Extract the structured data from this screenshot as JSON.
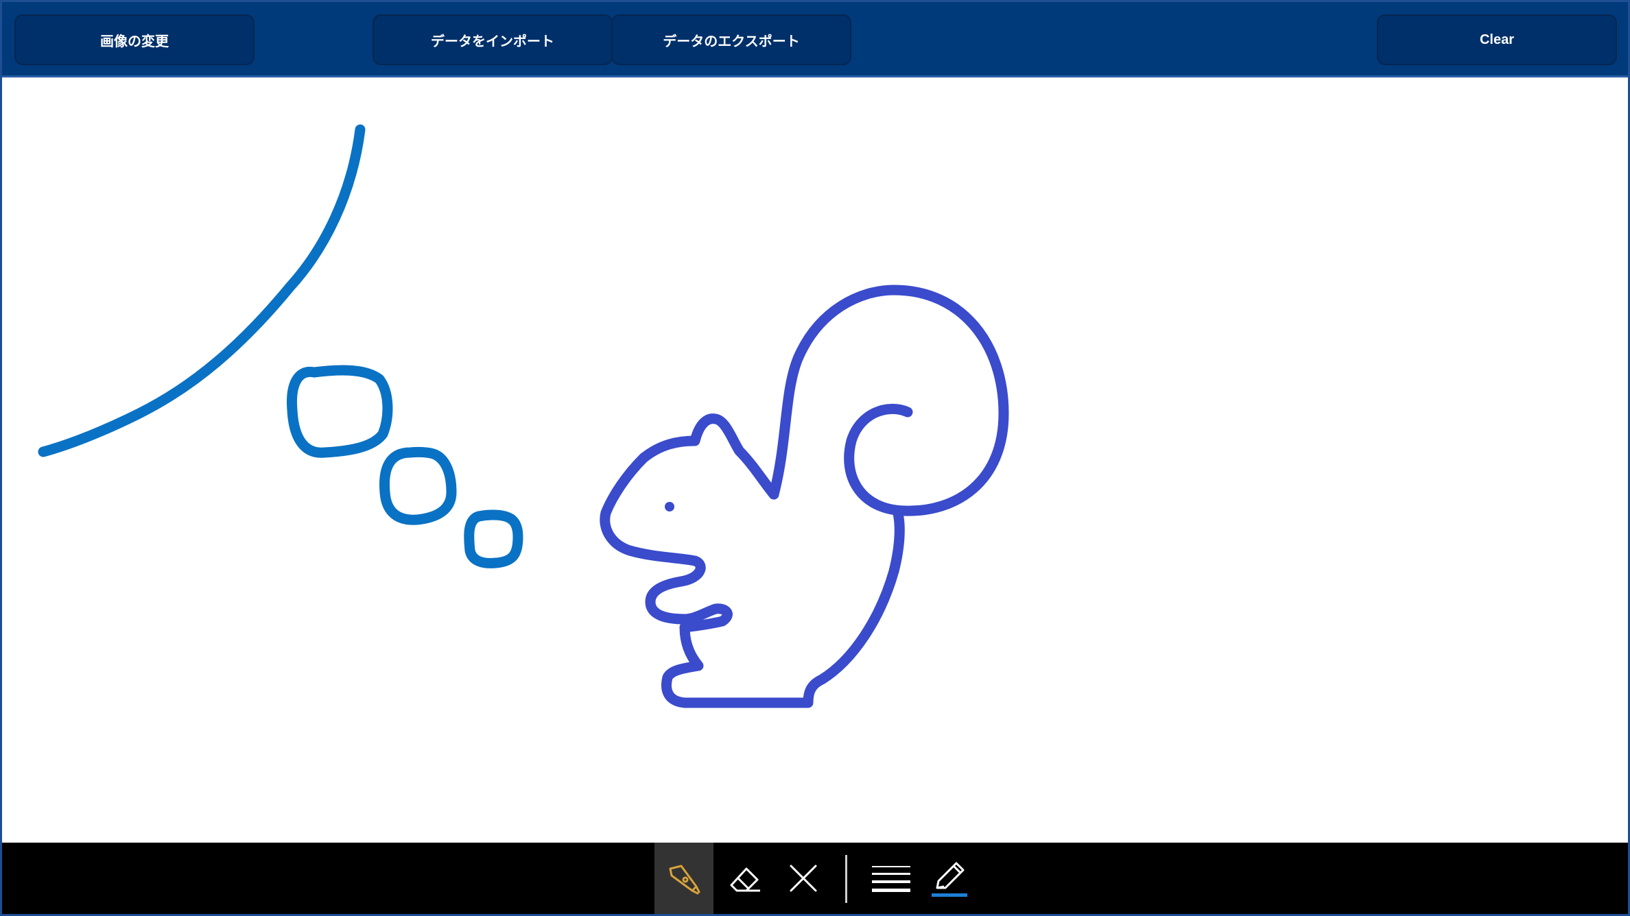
{
  "toolbar_top": {
    "change_image_label": "画像の変更",
    "import_data_label": "データをインポート",
    "export_data_label": "データのエクスポート",
    "clear_label": "Clear"
  },
  "colors": {
    "header_bg": "#003a7a",
    "button_bg": "#00306a",
    "ink_stroke": "#0a72c4",
    "squirrel_stroke": "#3a4bcc",
    "pen_icon_color": "#d9a33a",
    "active_ink_underline": "#1e7fd6"
  },
  "pen_toolbar": {
    "tools": [
      {
        "name": "ballpoint-pen",
        "icon": "pen-nib-icon",
        "active": true
      },
      {
        "name": "eraser",
        "icon": "eraser-icon",
        "active": false
      },
      {
        "name": "clear-ink",
        "icon": "close-icon",
        "active": false
      },
      {
        "name": "stroke-thickness",
        "icon": "lines-icon",
        "active": false
      },
      {
        "name": "pen-color",
        "icon": "pencil-icon",
        "active": false
      }
    ]
  }
}
